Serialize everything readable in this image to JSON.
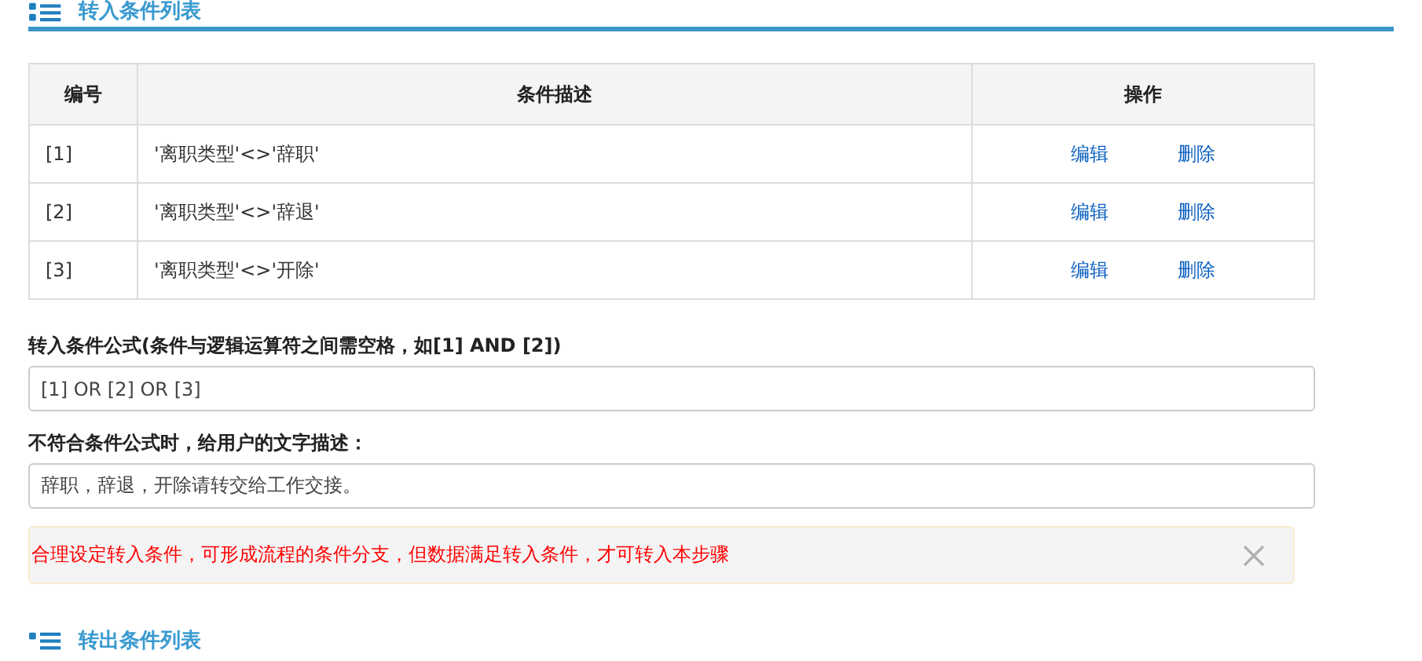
{
  "section_title": "转入条件列表",
  "table": {
    "columns": [
      "编号",
      "条件描述",
      "操作"
    ],
    "rows": [
      {
        "number": "[1]",
        "description": "'离职类型'<>'辞职'",
        "actions": [
          "编辑",
          "删除"
        ]
      },
      {
        "number": "[2]",
        "description": "'离职类型'<>'辞退'",
        "actions": [
          "编辑",
          "删除"
        ]
      },
      {
        "number": "[3]",
        "description": "'离职类型'<>'开除'",
        "actions": [
          "编辑",
          "删除"
        ]
      }
    ]
  },
  "formula": {
    "label": "转入条件公式(条件与逻辑运算符之间需空格，如[1] AND [2])",
    "value": "[1] OR [2] OR [3]"
  },
  "message": {
    "label": "不符合条件公式时，给用户的文字描述：",
    "value": "辞职，辞退，开除请转交给工作交接。"
  },
  "alert": {
    "text": "合理设定转入条件，可形成流程的条件分支，但数据满足转入条件，才可转入本步骤"
  },
  "next_section_title": "转出条件列表"
}
